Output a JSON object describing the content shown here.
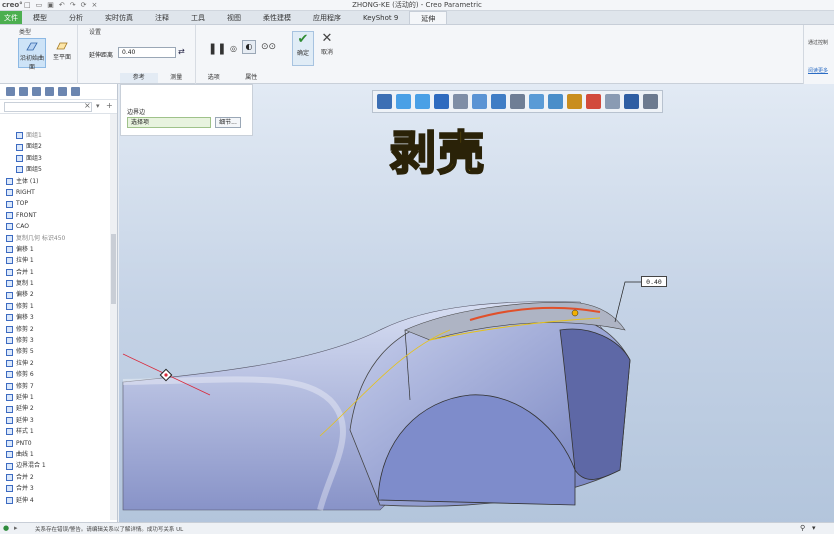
{
  "app": {
    "logo": "creo°",
    "window_title": "ZHONG-KE (活动的) - Creo Parametric"
  },
  "menu": {
    "file": "文件",
    "items": [
      "模型",
      "分析",
      "实时仿真",
      "注释",
      "工具",
      "视图",
      "柔性建模",
      "应用程序",
      "KeyShot 9"
    ],
    "active": "延伸"
  },
  "ribbon": {
    "type_group": "类型",
    "type_btn1": "沿初始曲面",
    "type_btn2": "至平面",
    "settings_group": "设置",
    "distance_label": "延伸距离",
    "distance_value": "0.40",
    "confirm": "确定",
    "cancel": "取消",
    "tabs": [
      "参考",
      "测量",
      "选项",
      "属性"
    ]
  },
  "ref_panel": {
    "label": "边界边",
    "field": "选择项",
    "button": "细节..."
  },
  "right_pane": {
    "line1": "通过控制",
    "line2": "阅读更多"
  },
  "tree": {
    "rows": [
      {
        "label": "面组1",
        "dim": true
      },
      {
        "label": "面组2",
        "dim": false
      },
      {
        "label": "面组3",
        "dim": false
      },
      {
        "label": "面组5",
        "dim": false
      },
      {
        "label": "主体 (1)",
        "dim": false
      },
      {
        "label": "RIGHT",
        "dim": false
      },
      {
        "label": "TOP",
        "dim": false
      },
      {
        "label": "FRONT",
        "dim": false
      },
      {
        "label": "CAO",
        "dim": false
      },
      {
        "label": "复制几何 标识450",
        "dim": true
      },
      {
        "label": "偏移 1",
        "dim": false
      },
      {
        "label": "拉伸 1",
        "dim": false
      },
      {
        "label": "合并 1",
        "dim": false
      },
      {
        "label": "复制 1",
        "dim": false
      },
      {
        "label": "偏移 2",
        "dim": false
      },
      {
        "label": "修剪 1",
        "dim": false
      },
      {
        "label": "偏移 3",
        "dim": false
      },
      {
        "label": "修剪 2",
        "dim": false
      },
      {
        "label": "修剪 3",
        "dim": false
      },
      {
        "label": "修剪 5",
        "dim": false
      },
      {
        "label": "拉伸 2",
        "dim": false
      },
      {
        "label": "修剪 6",
        "dim": false
      },
      {
        "label": "修剪 7",
        "dim": false
      },
      {
        "label": "延伸 1",
        "dim": false
      },
      {
        "label": "延伸 2",
        "dim": false
      },
      {
        "label": "延伸 3",
        "dim": false
      },
      {
        "label": "样式 1",
        "dim": false
      },
      {
        "label": "PNT0",
        "dim": false
      },
      {
        "label": "曲线 1",
        "dim": false
      },
      {
        "label": "边界混合 1",
        "dim": false
      },
      {
        "label": "合并 2",
        "dim": false
      },
      {
        "label": "合并 3",
        "dim": false
      },
      {
        "label": "延伸 4",
        "dim": false
      }
    ]
  },
  "viewport": {
    "overlay_text": "剥壳",
    "dimension_label": "0.40"
  },
  "status": {
    "message": "关系存在错误/警告。请编辑关系以了解详情。成功写关系 UL"
  }
}
